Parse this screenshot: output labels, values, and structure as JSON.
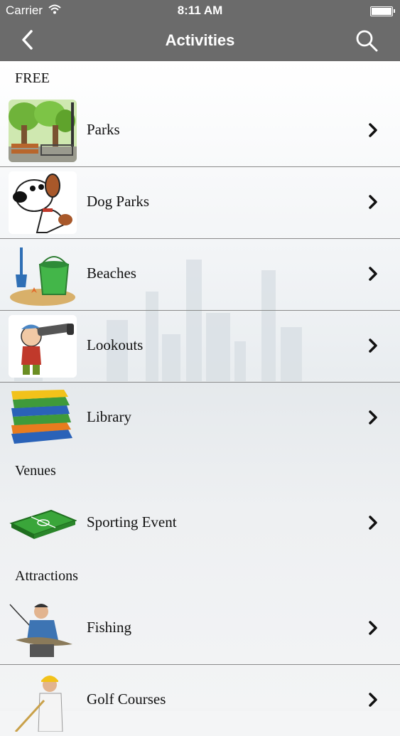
{
  "status_bar": {
    "carrier": "Carrier",
    "time": "8:11 AM"
  },
  "nav": {
    "title": "Activities",
    "back_icon": "chevron-left-icon",
    "search_icon": "search-icon"
  },
  "sections": [
    {
      "header": "FREE",
      "items": [
        {
          "label": "Parks",
          "icon": "park-icon"
        },
        {
          "label": "Dog Parks",
          "icon": "dog-icon"
        },
        {
          "label": "Beaches",
          "icon": "beach-bucket-icon"
        },
        {
          "label": "Lookouts",
          "icon": "lookout-telescope-icon"
        },
        {
          "label": "Library",
          "icon": "books-icon"
        }
      ]
    },
    {
      "header": "Venues",
      "items": [
        {
          "label": "Sporting Event",
          "icon": "soccer-field-icon"
        }
      ]
    },
    {
      "header": "Attractions",
      "items": [
        {
          "label": "Fishing",
          "icon": "fisherman-icon"
        },
        {
          "label": "Golf Courses",
          "icon": "golfer-icon"
        }
      ]
    }
  ],
  "colors": {
    "nav_bg": "#6b6b6b",
    "nav_text": "#ffffff",
    "divider": "#8a8a8a"
  }
}
